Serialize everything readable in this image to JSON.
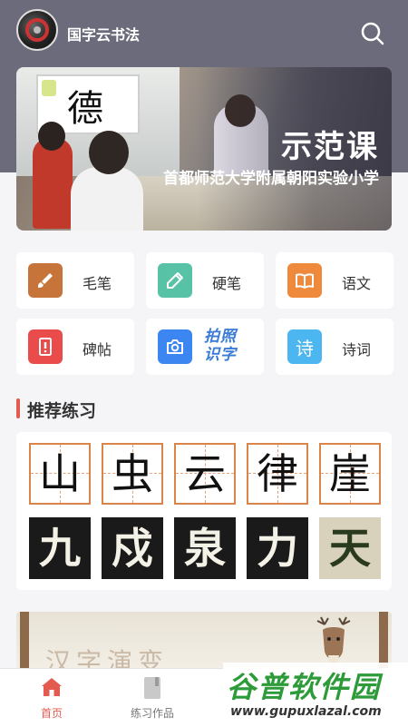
{
  "header": {
    "app_title": "国字云书法",
    "search_icon": "search-icon"
  },
  "banner": {
    "title": "示范课",
    "subtitle": "首都师范大学附属朝阳实验小学",
    "board_char": "德"
  },
  "categories": [
    {
      "label": "毛笔",
      "icon": "brush-icon",
      "color": "#c7743a"
    },
    {
      "label": "硬笔",
      "icon": "pencil-icon",
      "color": "#57c2a6"
    },
    {
      "label": "语文",
      "icon": "book-icon",
      "color": "#ef8a3c"
    },
    {
      "label": "碑帖",
      "icon": "tablet-icon",
      "color": "#ea4b4b"
    },
    {
      "label": "拍照识字",
      "icon": "camera-icon",
      "color": "#3b86f0"
    },
    {
      "label": "诗词",
      "icon": "poem-icon",
      "color": "#4bb6ef",
      "glyph": "诗"
    }
  ],
  "photo_label": {
    "line1": "拍照",
    "line2": "识字"
  },
  "recommend": {
    "section_title": "推荐练习",
    "grid_chars": [
      "山",
      "虫",
      "云",
      "律",
      "崖"
    ],
    "rubbing_chars": [
      "九",
      "戍",
      "泉",
      "力",
      "天"
    ]
  },
  "promo": {
    "text": "汉字演变"
  },
  "tabbar": {
    "items": [
      {
        "label": "首页",
        "active": true
      },
      {
        "label": "练习作品",
        "active": false
      }
    ]
  },
  "watermark": {
    "big": "谷普软件园",
    "small": "www.gupuxlazal.com"
  },
  "colors": {
    "accent": "#e35a4e",
    "topbar": "#6b6b7b"
  }
}
